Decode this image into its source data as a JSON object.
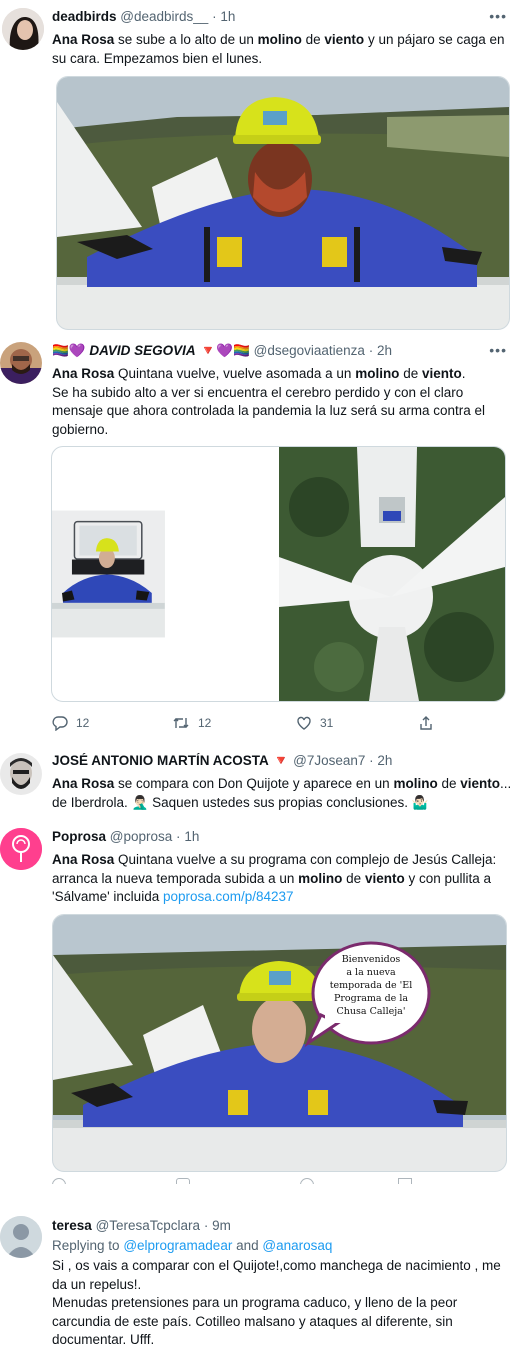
{
  "tweets": [
    {
      "name": "deadbirds",
      "handle": "@deadbirds__",
      "sep": "·",
      "time": "1h",
      "lines": [
        [
          {
            "t": "Ana Rosa",
            "b": true
          },
          {
            "t": " se sube a lo alto de un "
          },
          {
            "t": "molino",
            "b": true
          },
          {
            "t": " de "
          },
          {
            "t": "viento",
            "b": true
          },
          {
            "t": " y un pájaro se caga en"
          }
        ],
        [
          {
            "t": "su cara. Empezamos bien el lunes."
          }
        ]
      ]
    },
    {
      "name_prefix": "🏳️‍🌈💜",
      "name": "DAVID SEGOVIA",
      "name_suffix": "🔻💜🏳️‍🌈",
      "handle": "@dsegoviaatienza",
      "sep": "·",
      "time": "2h",
      "lines": [
        [
          {
            "t": "Ana Rosa",
            "b": true
          },
          {
            "t": " Quintana vuelve, vuelve asomada a un "
          },
          {
            "t": "molino",
            "b": true
          },
          {
            "t": " de "
          },
          {
            "t": "viento",
            "b": true
          },
          {
            "t": "."
          }
        ],
        [
          {
            "t": "Se ha subido alto a ver si encuentra el cerebro perdido y con el claro"
          }
        ],
        [
          {
            "t": "mensaje que ahora controlada la pandemia la luz será su arma contra el"
          }
        ],
        [
          {
            "t": "gobierno."
          }
        ]
      ],
      "replies": "12",
      "retweets": "12",
      "likes": "31"
    },
    {
      "name": "JOSÉ ANTONIO MARTÍN ACOSTA",
      "name_suffix": "🔻",
      "handle": "@7Josean7",
      "sep": "·",
      "time": "2h",
      "lines": [
        [
          {
            "t": "Ana Rosa",
            "b": true
          },
          {
            "t": " se compara con Don Quijote y aparece en un "
          },
          {
            "t": "molino",
            "b": true
          },
          {
            "t": " de "
          },
          {
            "t": "viento",
            "b": true
          },
          {
            "t": "..."
          }
        ],
        [
          {
            "t": "de Iberdrola. 🤦🏻‍♂️ Saquen ustedes sus propias conclusiones. 🤷🏻‍♂️"
          }
        ]
      ]
    },
    {
      "name": "Poprosa",
      "handle": "@poprosa",
      "sep": "·",
      "time": "1h",
      "lines": [
        [
          {
            "t": "Ana Rosa",
            "b": true
          },
          {
            "t": " Quintana vuelve a su programa con complejo de Jesús Calleja:"
          }
        ],
        [
          {
            "t": "arranca la nueva temporada subida a un "
          },
          {
            "t": "molino",
            "b": true
          },
          {
            "t": " de "
          },
          {
            "t": "viento",
            "b": true
          },
          {
            "t": " y con pullita a"
          }
        ],
        [
          {
            "t": "'Sálvame' incluida "
          },
          {
            "t": "poprosa.com/p/84237",
            "link": true
          }
        ]
      ],
      "bubble": [
        "Bienvenidos",
        "a la nueva",
        "temporada de  'El",
        "Programa de la",
        "Chusa Calleja'"
      ]
    },
    {
      "name": "teresa",
      "handle": "@TeresaTcpclara",
      "sep": "·",
      "time": "9m",
      "replying_label": "Replying to",
      "replying_1": "@elprogramadear",
      "replying_and": "and",
      "replying_2": "@anarosaq",
      "lines": [
        [
          {
            "t": "Si , os vais a comparar con el Quijote!,como manchega de nacimiento , me"
          }
        ],
        [
          {
            "t": "da un repelus!."
          }
        ],
        [
          {
            "t": "Menudas pretensiones para un programa caduco, y lleno de la peor"
          }
        ],
        [
          {
            "t": "carcundia de este país. Cotilleo malsano y ataques al diferente, sin"
          }
        ],
        [
          {
            "t": "documentar. Ufff."
          }
        ]
      ]
    }
  ],
  "icons": {
    "more": "more-icon",
    "reply": "reply-icon",
    "retweet": "retweet-icon",
    "like": "like-icon",
    "share": "share-icon"
  },
  "colors": {
    "link": "#1d9bf0",
    "text": "#0f1419",
    "secondary": "#536471",
    "helmet": "#d7e21b",
    "suit": "#3046b8"
  }
}
